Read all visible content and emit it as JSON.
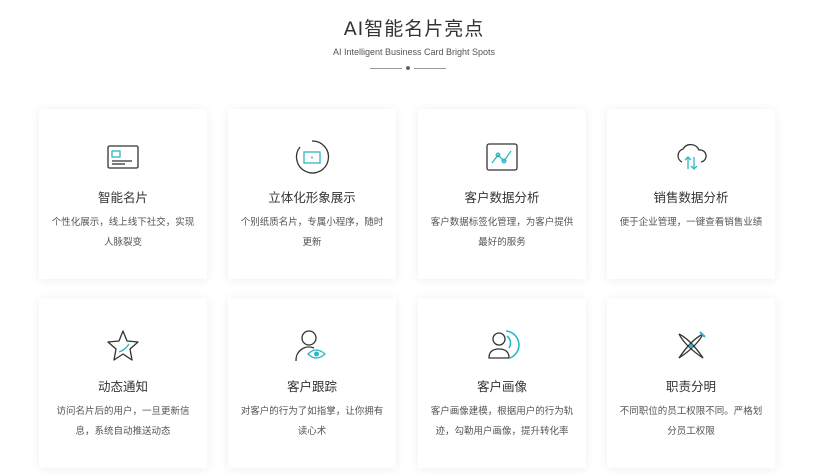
{
  "header": {
    "title": "AI智能名片亮点",
    "subtitle": "AI Intelligent Business Card Bright Spots"
  },
  "cards": [
    {
      "icon": "business-card-icon",
      "title": "智能名片",
      "desc": "个性化展示，线上线下社交，实现人脉裂变"
    },
    {
      "icon": "3d-display-icon",
      "title": "立体化形象展示",
      "desc": "个别纸质名片，专属小程序，随时更新"
    },
    {
      "icon": "data-chart-icon",
      "title": "客户数据分析",
      "desc": "客户数据标签化管理，为客户提供最好的服务"
    },
    {
      "icon": "cloud-sync-icon",
      "title": "销售数据分析",
      "desc": "便于企业管理，一键查看销售业绩"
    },
    {
      "icon": "star-icon",
      "title": "动态通知",
      "desc": "访问名片后的用户，一旦更新信息，系统自动推送动态"
    },
    {
      "icon": "user-eye-icon",
      "title": "客户跟踪",
      "desc": "对客户的行为了如指掌，让你拥有读心术"
    },
    {
      "icon": "user-portrait-icon",
      "title": "客户画像",
      "desc": "客户画像建模，根据用户的行为轨迹，勾勒用户画像，提升转化率"
    },
    {
      "icon": "permission-icon",
      "title": "职责分明",
      "desc": "不同职位的员工权限不同。严格划分员工权限"
    }
  ],
  "colors": {
    "accent": "#2bb7c8",
    "stroke": "#333333"
  }
}
